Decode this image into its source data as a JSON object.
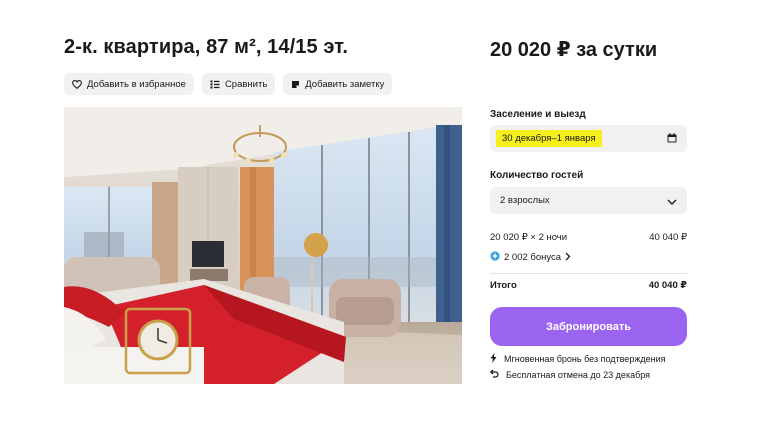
{
  "listing": {
    "title": "2-к. квартира, 87 м², 14/15 эт.",
    "actions": {
      "favorite": "Добавить в избранное",
      "compare": "Сравнить",
      "note": "Добавить заметку"
    }
  },
  "booking": {
    "price": "20 020 ₽ за сутки",
    "checkin_label": "Заселение и выезд",
    "dates": "30 декабря–1 января",
    "guests_label": "Количество гостей",
    "guests": "2 взрослых",
    "nights_calc": "20 020 ₽ × 2 ночи",
    "nights_amount": "40 040 ₽",
    "bonus": "2 002 бонуса",
    "total_label": "Итого",
    "total_amount": "40 040 ₽",
    "book_button": "Забронировать",
    "instant_note": "Мгновенная бронь без подтверждения",
    "cancel_note": "Бесплатная отмена до 23 декабря"
  },
  "colors": {
    "accent": "#9a63f0",
    "date_highlight": "#f5ef1e",
    "chip_bg": "#f2f1f0",
    "bonus_icon": "#3aa6dd"
  },
  "icons": {
    "favorite": "heart-icon",
    "compare": "compare-icon",
    "note": "note-icon",
    "calendar": "calendar-icon",
    "dropdown": "chevron-down-icon",
    "bonus": "bonus-icon",
    "bonus_more": "chevron-right-icon",
    "instant": "lightning-icon",
    "cancel": "undo-arrow-icon"
  }
}
